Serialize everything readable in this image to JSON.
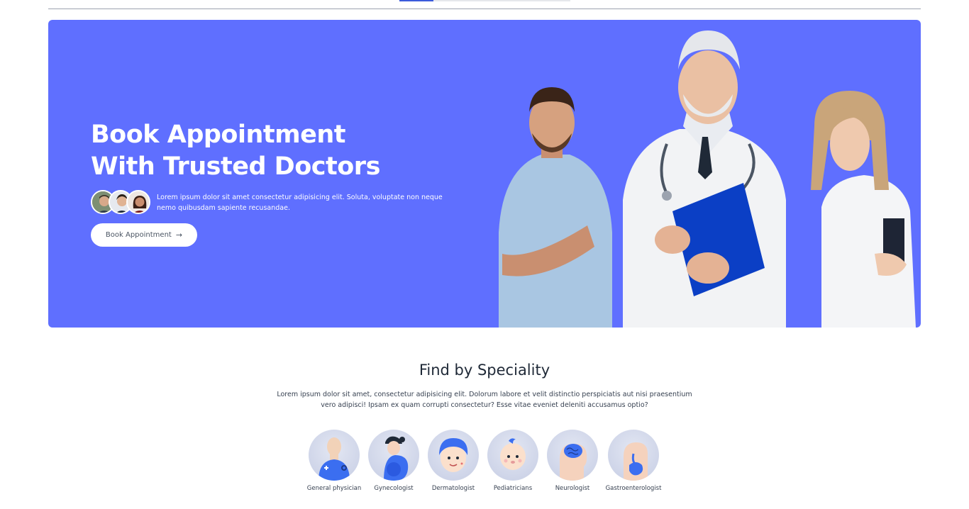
{
  "hero": {
    "title_line1": "Book Appointment",
    "title_line2": "With Trusted Doctors",
    "description": "Lorem ipsum dolor sit amet consectetur adipisicing elit. Soluta, voluptate non neque nemo quibusdam sapiente recusandae.",
    "cta_label": "Book Appointment",
    "cta_arrow": "→",
    "bg_color": "#5f6fff"
  },
  "speciality": {
    "title": "Find by Speciality",
    "description": "Lorem ipsum dolor sit amet, consectetur adipisicing elit. Dolorum labore et velit distinctio perspiciatis aut nisi praesentium vero adipisci! Ipsam ex quam corrupti consectetur? Esse vitae eveniet deleniti accusamus optio?",
    "items": [
      {
        "label": "General physician",
        "icon": "general-physician-icon"
      },
      {
        "label": "Gynecologist",
        "icon": "gynecologist-icon"
      },
      {
        "label": "Dermatologist",
        "icon": "dermatologist-icon"
      },
      {
        "label": "Pediatricians",
        "icon": "pediatrician-icon"
      },
      {
        "label": "Neurologist",
        "icon": "neurologist-icon"
      },
      {
        "label": "Gastroenterologist",
        "icon": "gastroenterologist-icon"
      }
    ]
  }
}
